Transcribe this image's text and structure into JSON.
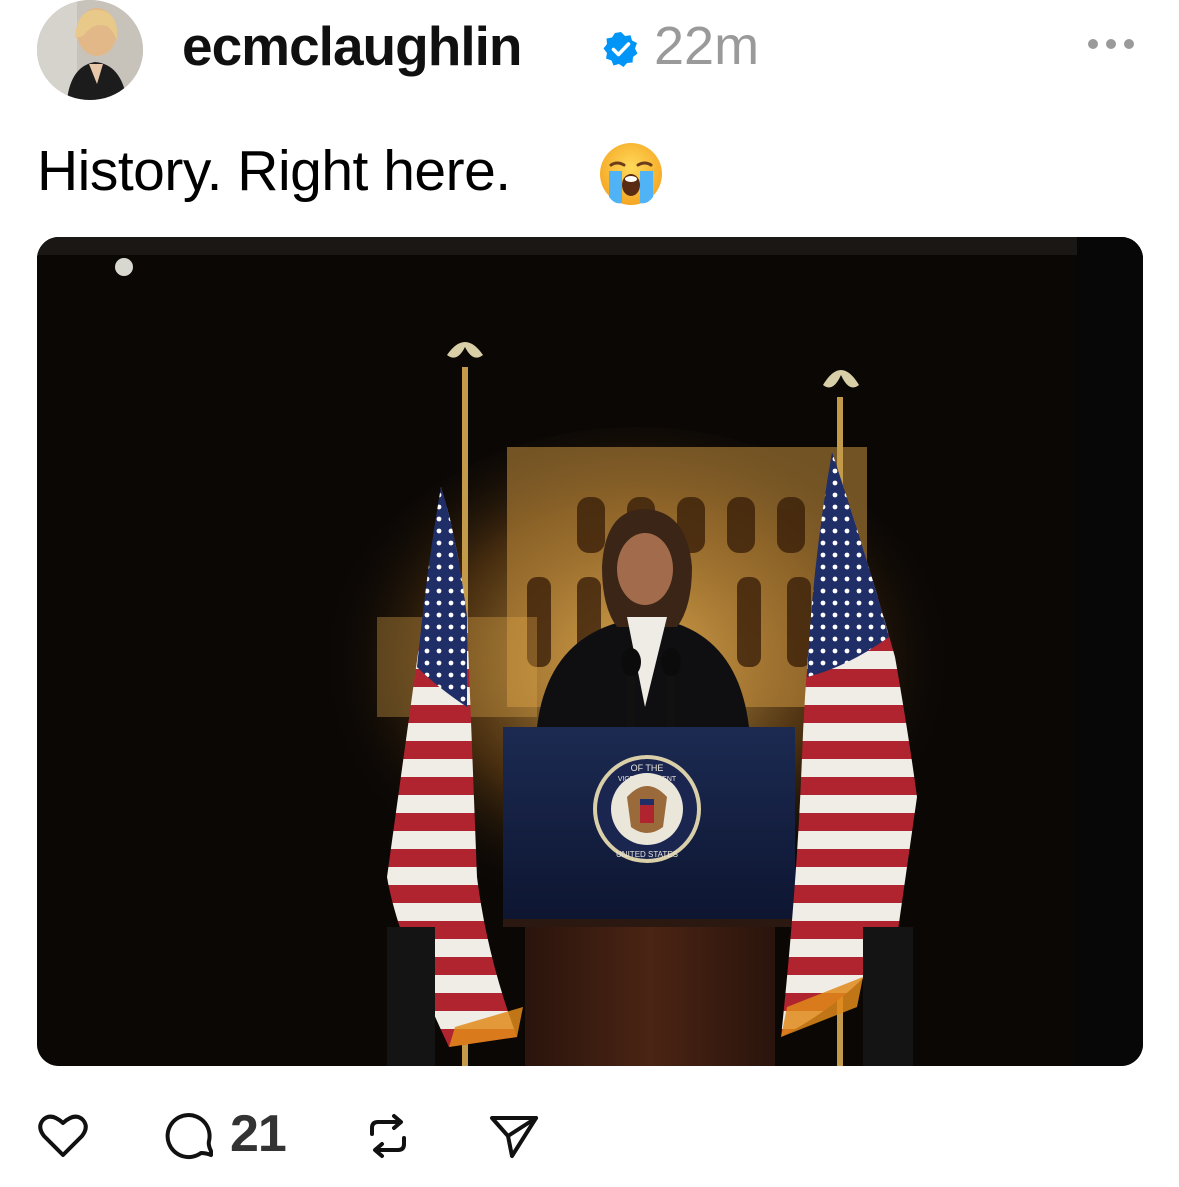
{
  "post": {
    "username": "ecmclaughlin",
    "timestamp": "22m",
    "caption": "History. Right here.",
    "caption_emoji_icon": "loudly-crying-face-icon",
    "verified_icon": "verified-badge-icon",
    "more_icon": "more-options-icon",
    "photo": {
      "seal_lines": [
        "VICE PRESIDENT",
        "OF THE",
        "UNITED STATES"
      ]
    }
  },
  "actions": {
    "like_icon": "heart-icon",
    "reply_icon": "comment-icon",
    "reply_count": "21",
    "repost_icon": "repost-icon",
    "share_icon": "send-icon"
  },
  "colors": {
    "verified_blue": "#0095f6",
    "muted_gray": "#9a9a9a",
    "text": "#000000"
  }
}
